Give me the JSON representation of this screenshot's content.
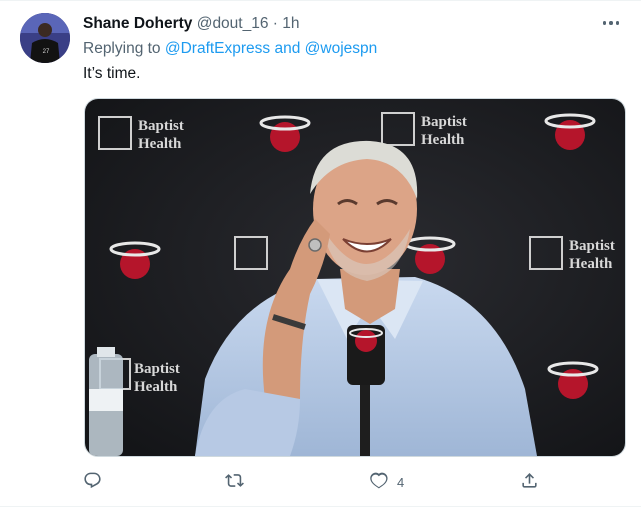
{
  "tweet": {
    "author_name": "Shane Doherty",
    "author_handle": "@dout_16",
    "separator": "·",
    "time": "1h",
    "reply_prefix": "Replying to ",
    "reply_mention_1": "@DraftExpress",
    "reply_and": " and ",
    "reply_mention_2": "@wojespn",
    "text": "It’s time.",
    "likes": "4"
  },
  "icons": {
    "more": "more-horizontal-icon",
    "reply": "reply-icon",
    "retweet": "retweet-icon",
    "like": "heart-icon",
    "share": "share-icon"
  },
  "media": {
    "backdrop_brand_1": "Baptist",
    "backdrop_brand_2": "Health"
  },
  "colors": {
    "accent": "#1d9bf0",
    "secondary_text": "#536471",
    "primary_text": "#0f1419"
  }
}
